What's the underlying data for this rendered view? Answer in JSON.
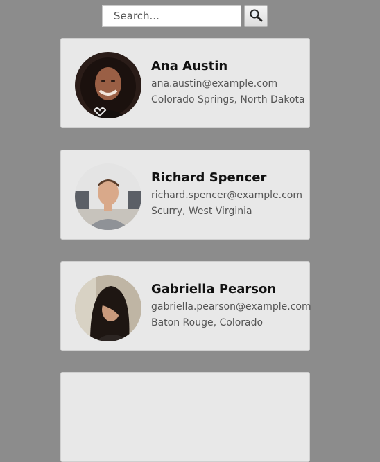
{
  "search": {
    "placeholder": "Search...",
    "button_icon": "magnifier-icon"
  },
  "users": [
    {
      "name": "Ana Austin",
      "email": "ana.austin@example.com",
      "location": "Colorado Springs, North Dakota"
    },
    {
      "name": "Richard Spencer",
      "email": "richard.spencer@example.com",
      "location": "Scurry, West Virginia"
    },
    {
      "name": "Gabriella Pearson",
      "email": "gabriella.pearson@example.com",
      "location": "Baton Rouge, Colorado"
    }
  ],
  "colors": {
    "page_background": "#8c8c8c",
    "card_background": "#e8e8e8"
  }
}
